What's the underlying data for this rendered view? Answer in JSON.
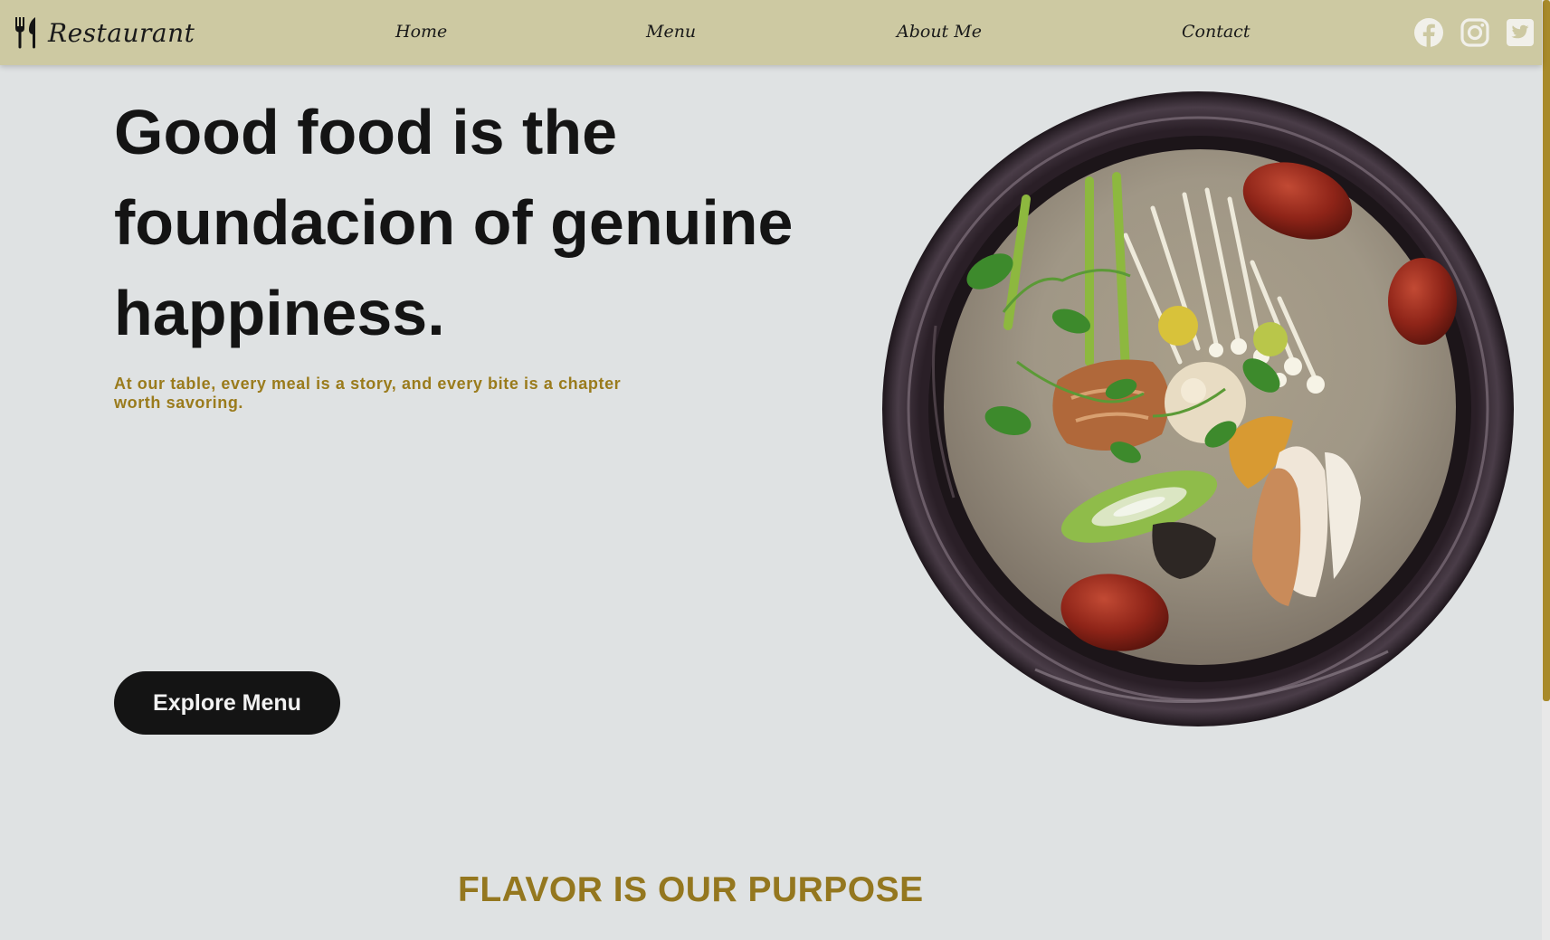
{
  "header": {
    "brand": "Restaurant",
    "nav": [
      "Home",
      "Menu",
      "About Me",
      "Contact"
    ],
    "social": [
      "facebook-icon",
      "instagram-icon",
      "twitter-icon"
    ]
  },
  "hero": {
    "title": "Good food is the foundacion of genuine happiness.",
    "subtitle": "At our table, every meal is a story, and every bite is a chapter worth savoring.",
    "cta": "Explore Menu"
  },
  "section": {
    "title": "FLAVOR IS OUR PURPOSE"
  },
  "colors": {
    "navbar": "#cdc9a2",
    "background": "#dfe2e3",
    "accent": "#9a7b1c",
    "button": "#141414"
  }
}
